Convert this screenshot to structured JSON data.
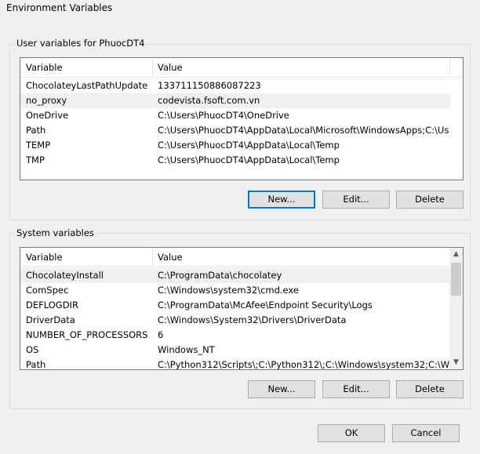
{
  "window": {
    "title": "Environment Variables"
  },
  "user_vars": {
    "group_label": "User variables for PhuocDT4",
    "columns": [
      "Variable",
      "Value"
    ],
    "rows": [
      {
        "name": "ChocolateyLastPathUpdate",
        "value": "133711150886087223"
      },
      {
        "name": "no_proxy",
        "value": "codevista.fsoft.com.vn"
      },
      {
        "name": "OneDrive",
        "value": "C:\\Users\\PhuocDT4\\OneDrive"
      },
      {
        "name": "Path",
        "value": "C:\\Users\\PhuocDT4\\AppData\\Local\\Microsoft\\WindowsApps;C:\\Us..."
      },
      {
        "name": "TEMP",
        "value": "C:\\Users\\PhuocDT4\\AppData\\Local\\Temp"
      },
      {
        "name": "TMP",
        "value": "C:\\Users\\PhuocDT4\\AppData\\Local\\Temp"
      }
    ],
    "buttons": {
      "new": "New...",
      "edit": "Edit...",
      "delete": "Delete"
    }
  },
  "system_vars": {
    "group_label": "System variables",
    "columns": [
      "Variable",
      "Value"
    ],
    "rows": [
      {
        "name": "ChocolateyInstall",
        "value": "C:\\ProgramData\\chocolatey"
      },
      {
        "name": "ComSpec",
        "value": "C:\\Windows\\system32\\cmd.exe"
      },
      {
        "name": "DEFLOGDIR",
        "value": "C:\\ProgramData\\McAfee\\Endpoint Security\\Logs"
      },
      {
        "name": "DriverData",
        "value": "C:\\Windows\\System32\\Drivers\\DriverData"
      },
      {
        "name": "NUMBER_OF_PROCESSORS",
        "value": "6"
      },
      {
        "name": "OS",
        "value": "Windows_NT"
      },
      {
        "name": "Path",
        "value": "C:\\Python312\\Scripts\\;C:\\Python312\\;C:\\Windows\\system32;C:\\Wi..."
      }
    ],
    "buttons": {
      "new": "New...",
      "edit": "Edit...",
      "delete": "Delete"
    },
    "scroll_arrows": {
      "up": "▲",
      "down": "▼"
    }
  },
  "dialog_buttons": {
    "ok": "OK",
    "cancel": "Cancel"
  },
  "colors": {
    "selected_row": "#f0f0f0",
    "default_button_border": "#0078d7"
  }
}
